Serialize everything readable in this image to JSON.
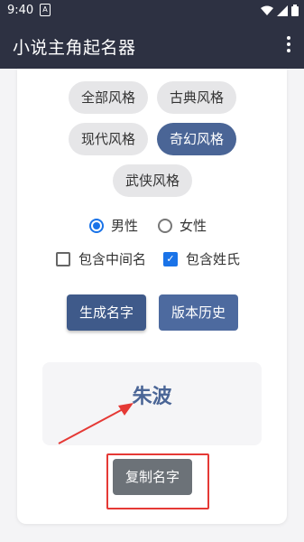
{
  "statusbar": {
    "time": "9:40",
    "notif_glyph": "A"
  },
  "appbar": {
    "title": "小说主角起名器"
  },
  "styles": [
    {
      "label": "全部风格",
      "active": false
    },
    {
      "label": "古典风格",
      "active": false
    },
    {
      "label": "现代风格",
      "active": false
    },
    {
      "label": "奇幻风格",
      "active": true
    },
    {
      "label": "武侠风格",
      "active": false
    }
  ],
  "gender": {
    "male_label": "男性",
    "female_label": "女性",
    "selected": "male"
  },
  "options": {
    "middle_name_label": "包含中间名",
    "middle_name_checked": false,
    "surname_label": "包含姓氏",
    "surname_checked": true
  },
  "buttons": {
    "generate_label": "生成名字",
    "history_label": "版本历史",
    "copy_label": "复制名字"
  },
  "result": {
    "name": "朱波"
  },
  "colors": {
    "appbar": "#2d3142",
    "accent": "#4a6596",
    "annotation": "#e53935"
  }
}
